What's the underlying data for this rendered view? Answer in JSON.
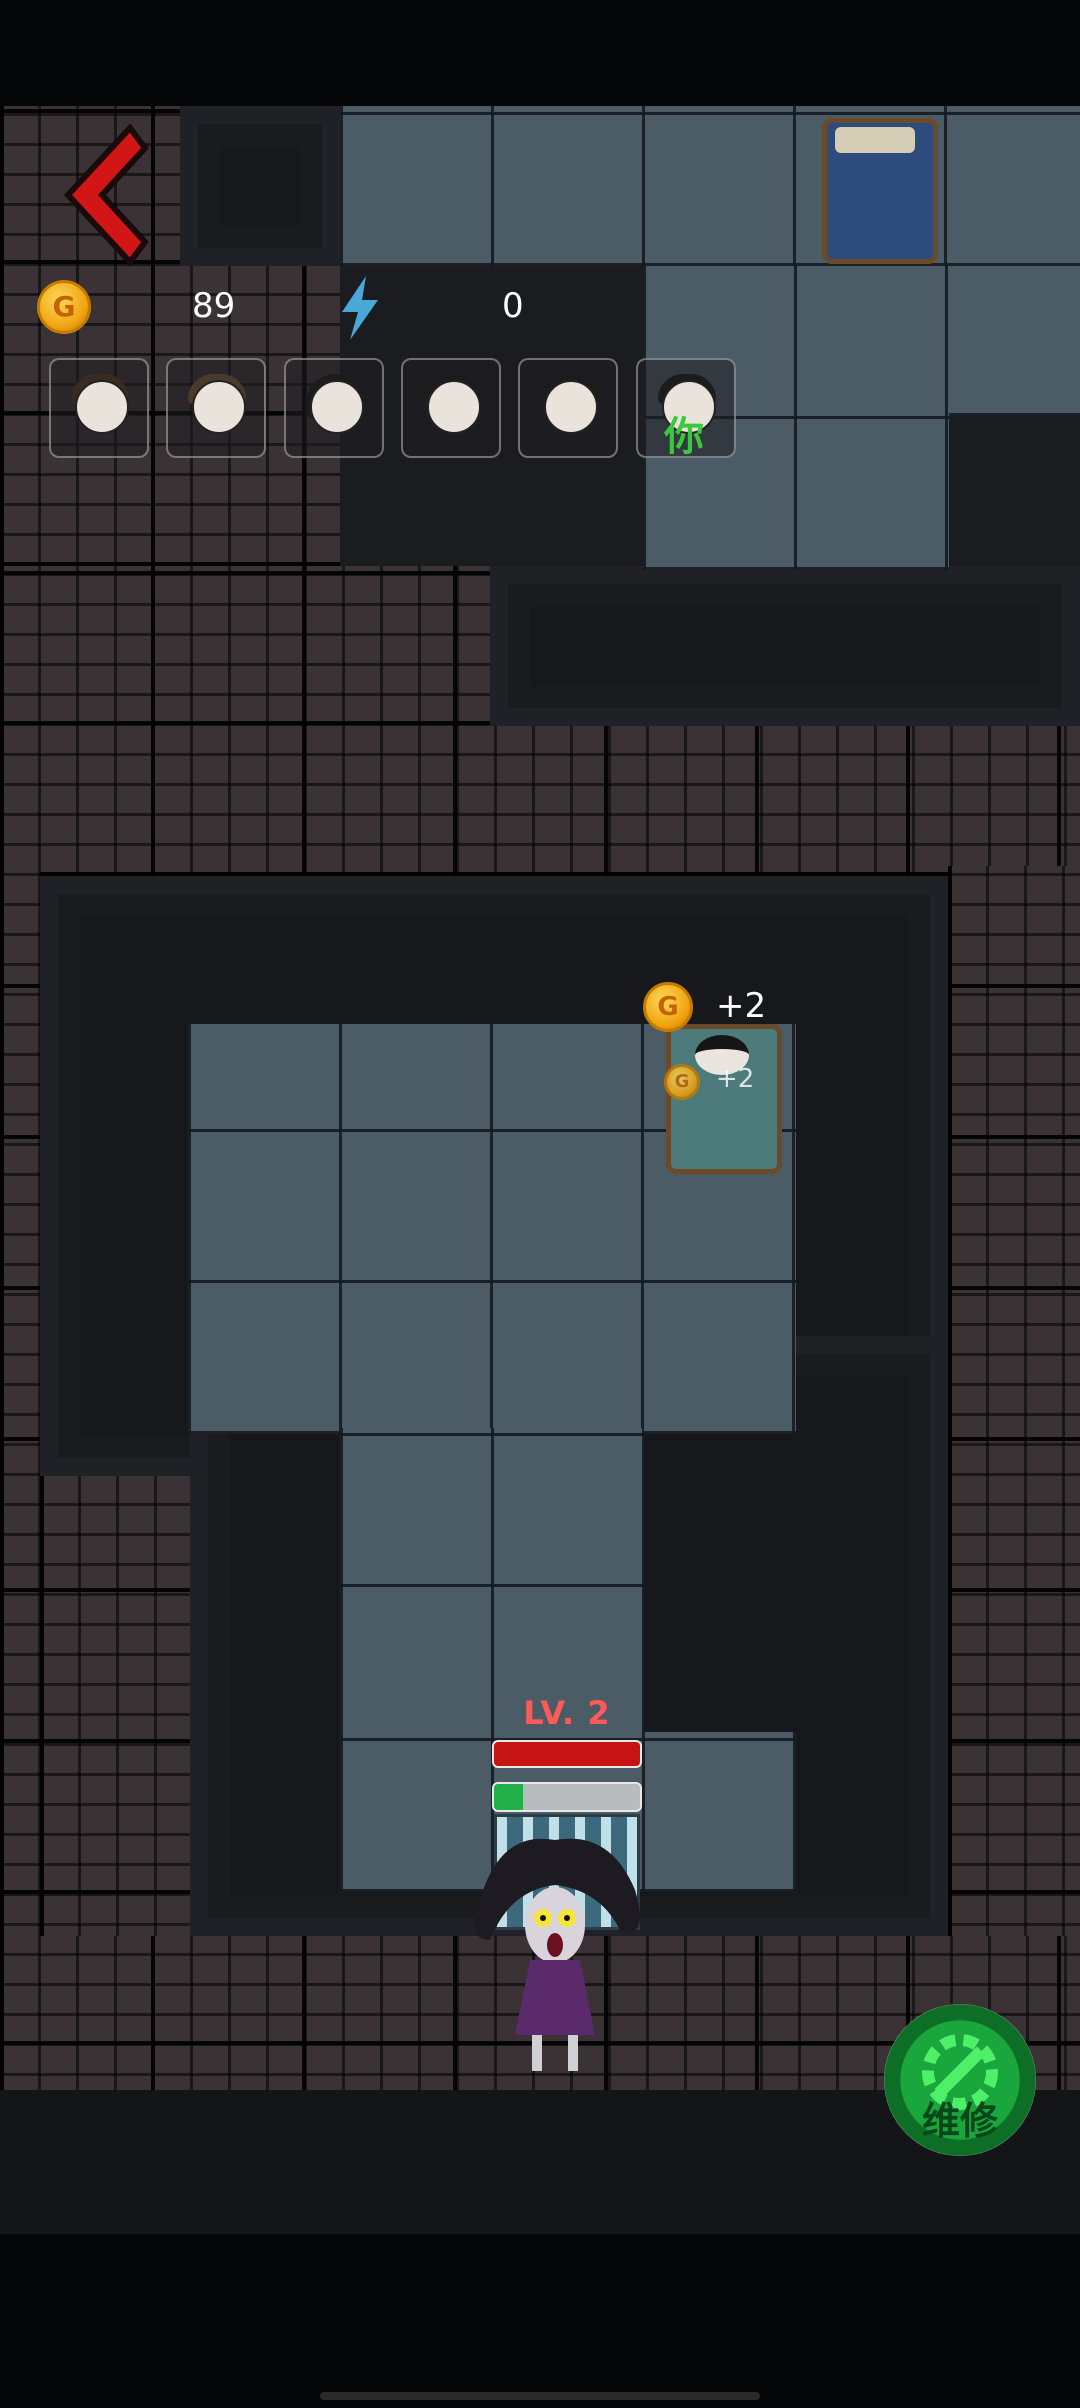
{
  "hud": {
    "coin_label": "G",
    "coins": "89",
    "energy": "0"
  },
  "characters": [
    {
      "name": "girl-1-avatar",
      "label": ""
    },
    {
      "name": "girl-2-avatar",
      "label": ""
    },
    {
      "name": "girl-3-avatar",
      "label": ""
    },
    {
      "name": "boy-1-avatar",
      "label": ""
    },
    {
      "name": "boy-2-avatar",
      "label": ""
    },
    {
      "name": "player-avatar",
      "label": "你"
    }
  ],
  "rewards": {
    "large_coin": "G",
    "large_text": "+2",
    "small_coin": "G",
    "small_text": "+2"
  },
  "enemy": {
    "level": "LV. 2",
    "health_fraction": 1.0,
    "progress_fraction": 0.2
  },
  "repair_button": {
    "label": "维修"
  },
  "colors": {
    "accent_green": "#22b04a",
    "health_red": "#c61414",
    "back_arrow_red": "#d21616",
    "level_text": "#ff5a5a"
  }
}
